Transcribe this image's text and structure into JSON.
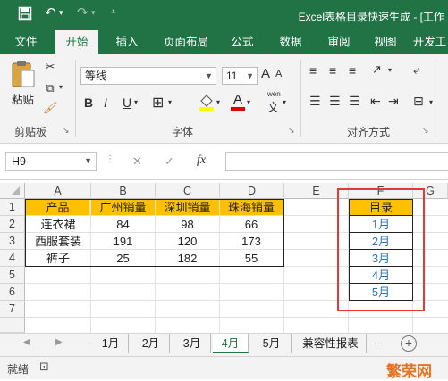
{
  "window": {
    "title": "Excel表格目录快速生成 - [工作"
  },
  "quick_access": {
    "save_icon": "save-icon",
    "undo_icon": "undo-icon",
    "redo_icon": "redo-icon"
  },
  "tabs": [
    "文件",
    "开始",
    "插入",
    "页面布局",
    "公式",
    "数据",
    "审阅",
    "视图",
    "开发工"
  ],
  "ribbon": {
    "paste_label": "粘贴",
    "clipboard_label": "剪贴板",
    "font_label": "字体",
    "align_label": "对齐方式",
    "font_name": "等线",
    "font_size": "11",
    "bold": "B",
    "italic": "I",
    "underline": "U",
    "grow": "A",
    "shrink": "A",
    "font_color_a": "A",
    "phonetic": "wén",
    "phonetic_char": "文"
  },
  "formula_bar": {
    "name_box": "H9",
    "cancel": "✕",
    "enter": "✓",
    "fx": "fx",
    "value": ""
  },
  "columns": [
    "A",
    "B",
    "C",
    "D",
    "E",
    "F",
    "G"
  ],
  "rows": [
    "1",
    "2",
    "3",
    "4",
    "5",
    "6",
    "7"
  ],
  "table": {
    "headers": [
      "产品",
      "广州销量",
      "深圳销量",
      "珠海销量"
    ],
    "rows": [
      [
        "连衣裙",
        "84",
        "98",
        "66"
      ],
      [
        "西服套装",
        "191",
        "120",
        "173"
      ],
      [
        "裤子",
        "25",
        "182",
        "55"
      ]
    ]
  },
  "catalog": {
    "header": "目录",
    "items": [
      "1月",
      "2月",
      "3月",
      "4月",
      "5月"
    ]
  },
  "sheet_tabs": [
    "1月",
    "2月",
    "3月",
    "4月",
    "5月",
    "兼容性报表"
  ],
  "active_sheet": "4月",
  "status": {
    "ready": "就绪"
  },
  "watermark": "繁荣网",
  "colors": {
    "excel_green": "#217346",
    "header_fill": "#ffc000",
    "link": "#2e75b6",
    "highlight_box": "#e53935"
  }
}
